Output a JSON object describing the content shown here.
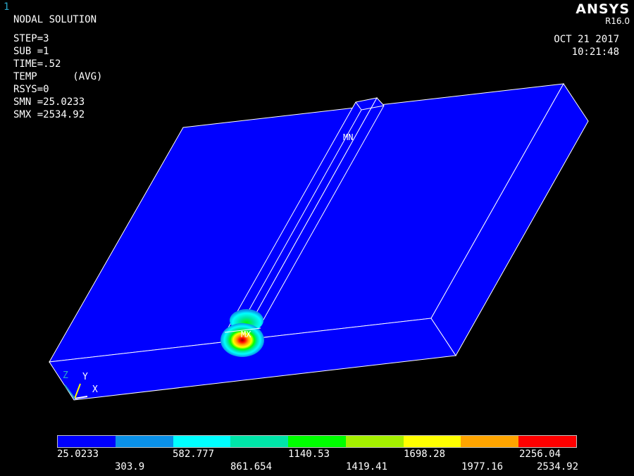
{
  "window_number": "1",
  "logo": {
    "name": "ANSYS",
    "version": "R16.0"
  },
  "info": {
    "title": "NODAL SOLUTION",
    "step": "STEP=3",
    "sub": "SUB =1",
    "time": "TIME=.52",
    "item": "TEMP      (AVG)",
    "rsys": "RSYS=0",
    "smn": "SMN =25.0233",
    "smx": "SMX =2534.92"
  },
  "date": "OCT 21 2017",
  "clock": "10:21:48",
  "markers": {
    "min": "MN",
    "max": "MX"
  },
  "triad": {
    "z": "Z",
    "y": "Y",
    "x": "X"
  },
  "legend": {
    "colors": [
      "#0000ff",
      "#0a90e8",
      "#00ffff",
      "#00e5a8",
      "#00ff00",
      "#a4f000",
      "#ffff00",
      "#ffa400",
      "#ff0000"
    ],
    "upper_labels": [
      "25.0233",
      "582.777",
      "1140.53",
      "1698.28",
      "2256.04"
    ],
    "lower_labels": [
      "303.9",
      "861.654",
      "1419.41",
      "1977.16",
      "2534.92"
    ]
  }
}
